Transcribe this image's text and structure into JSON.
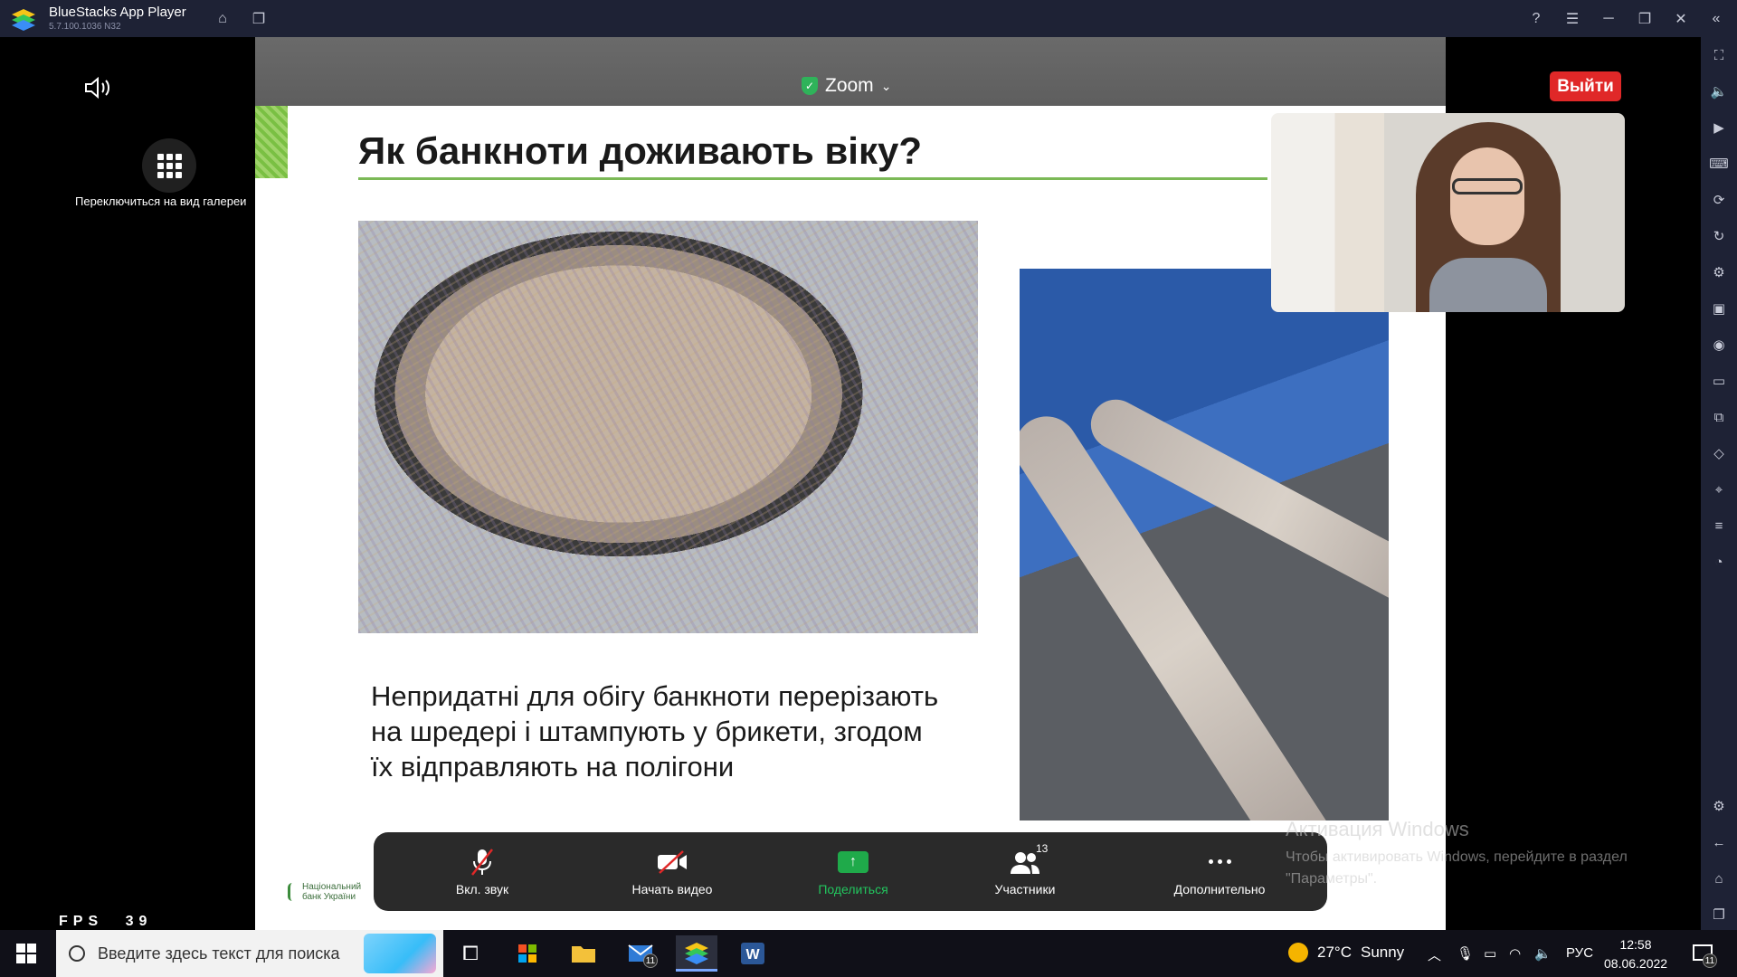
{
  "window": {
    "app_name": "BlueStacks App Player",
    "version": "5.7.100.1036  N32"
  },
  "zoom": {
    "meeting_label": "Zoom",
    "leave_button": "Выйти",
    "gallery_label": "Переключиться на вид галереи",
    "fps_label": "FPS",
    "fps_value": "39"
  },
  "slide": {
    "title": "Як банкноти доживають віку?",
    "body": "Непридатні для обігу банкноти перерізають на шредері і штампують у брикети, згодом їх відправляють на полігони",
    "logo_line1": "Національний",
    "logo_line2": "банк України"
  },
  "controls": {
    "audio": "Вкл. звук",
    "video": "Начать видео",
    "share": "Поделиться",
    "participants": "Участники",
    "participants_count": "13",
    "more": "Дополнительно"
  },
  "activation": {
    "title": "Активация Windows",
    "text": "Чтобы активировать Windows, перейдите в раздел \"Параметры\"."
  },
  "taskbar": {
    "search_placeholder": "Введите здесь текст для поиска",
    "mail_badge": "11",
    "weather_temp": "27°C",
    "weather_text": "Sunny",
    "language": "РУС",
    "time": "12:58",
    "date": "08.06.2022",
    "notification_count": "11"
  },
  "colors": {
    "accent_green": "#7bb956",
    "leave_red": "#e02828",
    "share_green": "#22c55e",
    "titlebar": "#1e2235"
  }
}
